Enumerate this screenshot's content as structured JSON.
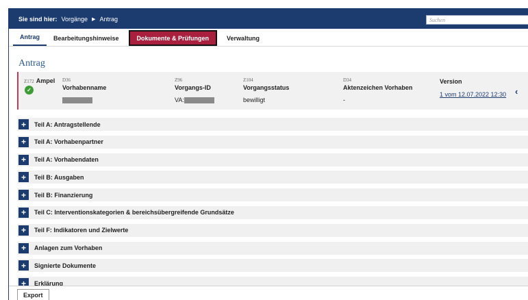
{
  "breadcrumb": {
    "lead": "Sie sind hier:",
    "items": [
      "Vorgänge",
      "Antrag"
    ]
  },
  "search": {
    "placeholder": "Suchen"
  },
  "tabs": [
    {
      "label": "Antrag"
    },
    {
      "label": "Bearbeitungshinweise"
    },
    {
      "label": "Dokumente & Prüfungen"
    },
    {
      "label": "Verwaltung"
    }
  ],
  "heading": "Antrag",
  "info": {
    "ampel": {
      "code": "Z172",
      "title": "Ampel"
    },
    "vorhabenname": {
      "code": "D36",
      "title": "Vorhabenname"
    },
    "vorgangs_id": {
      "code": "Z96",
      "title": "Vorgangs-ID",
      "prefix": "VA:"
    },
    "status": {
      "code": "Z104",
      "title": "Vorgangsstatus",
      "value": "bewilligt"
    },
    "aktenzeichen": {
      "code": "D34",
      "title": "Aktenzeichen Vorhaben",
      "value": "-"
    },
    "version": {
      "title": "Version",
      "value": "1 vom 12.07.2022 12:30"
    }
  },
  "sections": [
    "Teil A: Antragstellende",
    "Teil A: Vorhabenpartner",
    "Teil A: Vorhabendaten",
    "Teil B: Ausgaben",
    "Teil B: Finanzierung",
    "Teil C: Interventionskategorien & bereichsübergreifende Grundsätze",
    "Teil F: Indikatoren und Zielwerte",
    "Anlagen zum Vorhaben",
    "Signierte Dokumente",
    "Erklärung"
  ],
  "export_label": "Export",
  "colors": {
    "navy": "#1c3b6e",
    "tab_highlight": "#a8203e",
    "ampel_green": "#3f9b35"
  },
  "icons": {
    "expand": "plus-icon",
    "status": "check-icon",
    "collapse": "chevron-left-icon"
  }
}
